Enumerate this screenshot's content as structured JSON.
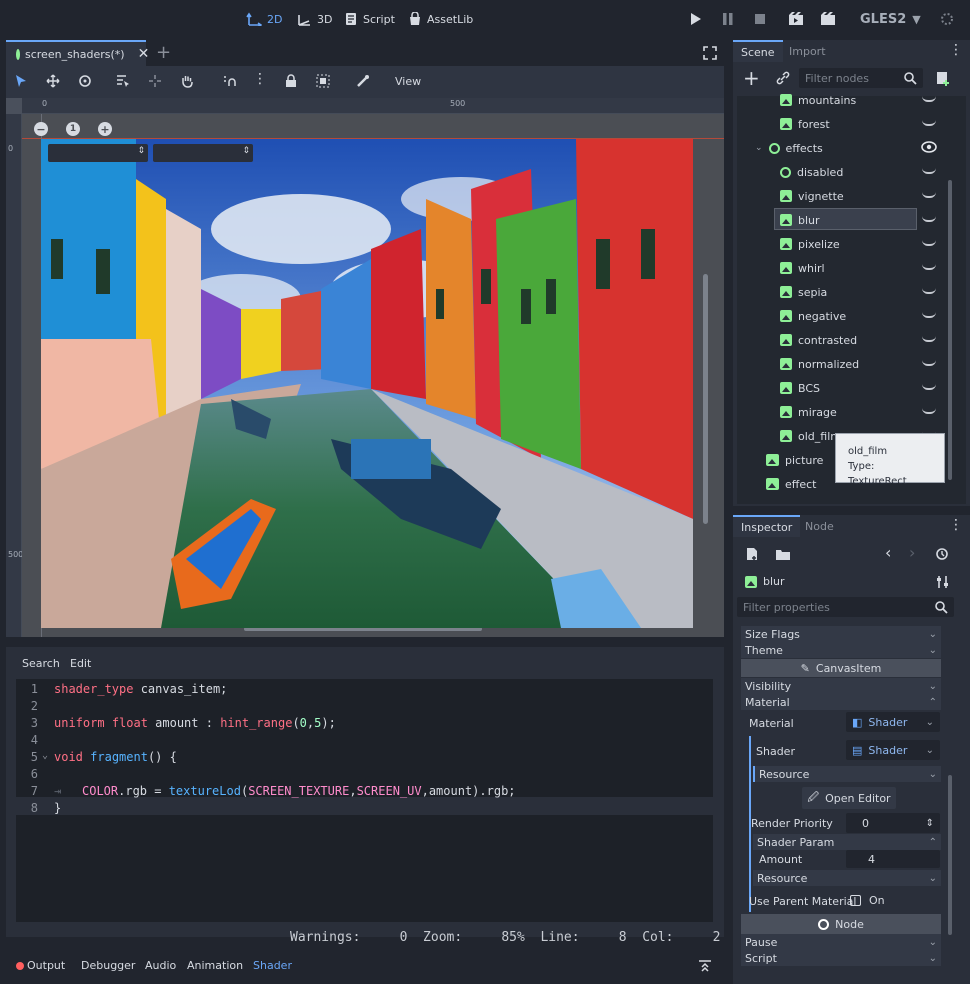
{
  "topbar": {
    "modes": [
      "2D",
      "3D",
      "Script",
      "AssetLib"
    ],
    "renderer": "GLES2"
  },
  "editor": {
    "tab_title": "screen_shaders(*)",
    "view_menu": "View",
    "ruler": {
      "top_0": "0",
      "top_500": "500",
      "left_0": "0",
      "left_500": "500"
    },
    "zoom_reset": "1"
  },
  "code_panel": {
    "menu_search": "Search",
    "menu_edit": "Edit",
    "lines": [
      {
        "n": "1",
        "text": "shader_type canvas_item;"
      },
      {
        "n": "2",
        "text": ""
      },
      {
        "n": "3",
        "text": "uniform float amount : hint_range(0,5);"
      },
      {
        "n": "4",
        "text": ""
      },
      {
        "n": "5",
        "text": "void fragment() {"
      },
      {
        "n": "6",
        "text": ""
      },
      {
        "n": "7",
        "text": "COLOR.rgb = textureLod(SCREEN_TEXTURE,SCREEN_UV,amount).rgb;"
      },
      {
        "n": "8",
        "text": "}"
      }
    ],
    "status": "Warnings:     0  Zoom:     85%  Line:     8  Col:     2"
  },
  "bottom_tabs": [
    "Output",
    "Debugger",
    "Audio",
    "Animation",
    "Shader"
  ],
  "scene": {
    "tab_scene": "Scene",
    "tab_import": "Import",
    "filter_placeholder": "Filter nodes",
    "nodes": [
      "mountains",
      "forest",
      "effects",
      "disabled",
      "vignette",
      "blur",
      "pixelize",
      "whirl",
      "sepia",
      "negative",
      "contrasted",
      "normalized",
      "BCS",
      "mirage",
      "old_film",
      "picture",
      "effect"
    ],
    "tooltip_name": "old_film",
    "tooltip_type": "Type: TextureRect"
  },
  "inspector": {
    "tab_inspector": "Inspector",
    "tab_node": "Node",
    "object": "blur",
    "filter_placeholder": "Filter properties",
    "size_flags": "Size Flags",
    "theme": "Theme",
    "canvas_item": "CanvasItem",
    "visibility": "Visibility",
    "material": "Material",
    "material_label": "Material",
    "material_value": "Shader",
    "shader_label": "Shader",
    "shader_value": "Shader",
    "resource1": "Resource",
    "open_editor": "Open Editor",
    "render_priority": "Render Priority",
    "render_priority_value": "0",
    "shader_param": "Shader Param",
    "amount": "Amount",
    "amount_value": "4",
    "resource2": "Resource",
    "use_parent_material": "Use Parent Material",
    "on": "On",
    "node": "Node",
    "pause": "Pause",
    "script": "Script"
  },
  "colors": {
    "accent": "#6aa7f8",
    "node_green": "#8eef97",
    "panel": "#2a2f3a",
    "background": "#21252e"
  }
}
